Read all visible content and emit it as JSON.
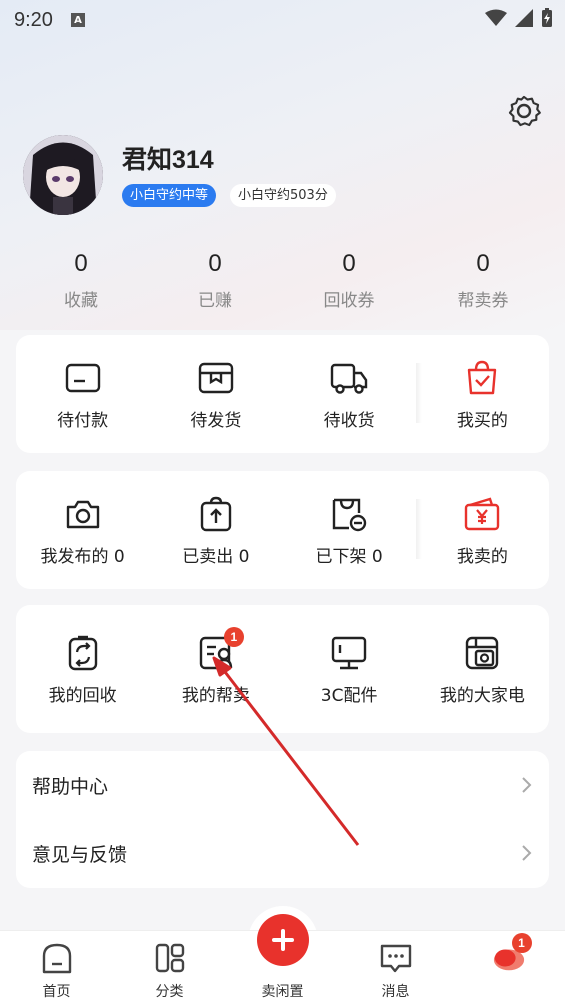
{
  "status_bar": {
    "time": "9:20",
    "notification_icon": "A"
  },
  "profile": {
    "username": "君知314",
    "level_badge": "小白守约中等",
    "score_badge": "小白守约503分"
  },
  "stats": [
    {
      "value": "0",
      "label": "收藏"
    },
    {
      "value": "0",
      "label": "已赚"
    },
    {
      "value": "0",
      "label": "回收券"
    },
    {
      "value": "0",
      "label": "帮卖券"
    }
  ],
  "buy_card": {
    "items": [
      {
        "label": "待付款",
        "icon": "wallet-icon"
      },
      {
        "label": "待发货",
        "icon": "box-icon"
      },
      {
        "label": "待收货",
        "icon": "truck-icon"
      },
      {
        "label": "我买的",
        "icon": "shopping-bag-icon"
      }
    ]
  },
  "sell_card": {
    "items": [
      {
        "label": "我发布的 0",
        "icon": "camera-icon"
      },
      {
        "label": "已卖出 0",
        "icon": "upload-bag-icon"
      },
      {
        "label": "已下架 0",
        "icon": "bag-minus-icon"
      },
      {
        "label": "我卖的",
        "icon": "yen-wallet-icon"
      }
    ]
  },
  "service_card": {
    "items": [
      {
        "label": "我的回收",
        "icon": "recycle-icon"
      },
      {
        "label": "我的帮卖",
        "icon": "help-sell-icon",
        "badge": "1"
      },
      {
        "label": "3C配件",
        "icon": "monitor-icon"
      },
      {
        "label": "我的大家电",
        "icon": "appliance-icon"
      }
    ]
  },
  "list": {
    "help_center": "帮助中心",
    "feedback": "意见与反馈"
  },
  "bottom_nav": {
    "home": "首页",
    "category": "分类",
    "sell": "卖闲置",
    "messages": "消息",
    "me_badge": "1"
  },
  "colors": {
    "accent": "#e8322c",
    "badge_blue": "#2b7bf0"
  }
}
